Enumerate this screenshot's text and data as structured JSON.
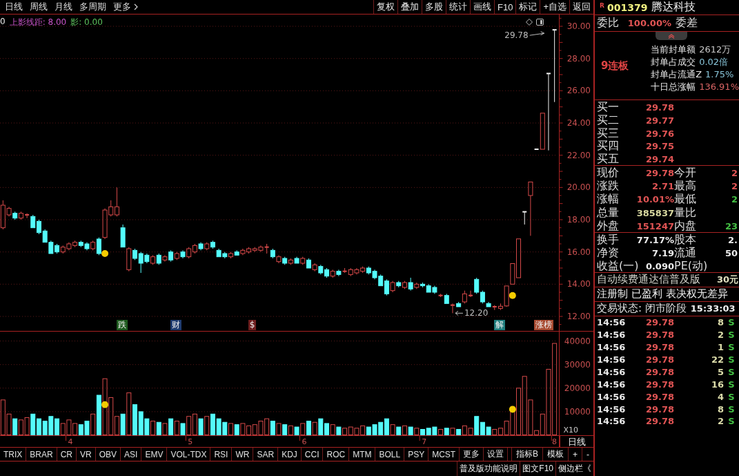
{
  "top_menu": {
    "items": [
      "日线",
      "周线",
      "月线",
      "多周期"
    ],
    "more": "更多"
  },
  "toolbar": [
    "复权",
    "叠加",
    "多股",
    "统计",
    "画线",
    "F10",
    "标记",
    "+自选",
    "返回"
  ],
  "chart_area": {
    "indicator_readout": {
      "prefix": "0",
      "items": [
        {
          "label": "上影线距:",
          "value": "8.00",
          "color": "#c854c8"
        },
        {
          "label": "影:",
          "value": "0.00",
          "color": "#5cc05c"
        }
      ]
    },
    "chart_data": [
      {
        "type": "candlestick",
        "ohlc": [
          [
            17.5,
            19.2,
            17.4,
            18.9
          ],
          [
            18.3,
            18.8,
            18.2,
            18.7
          ],
          [
            18.4,
            18.5,
            18.0,
            18.1
          ],
          [
            18.1,
            18.5,
            18.0,
            18.4
          ],
          [
            18.3,
            18.4,
            18.1,
            18.3
          ],
          [
            18.2,
            18.3,
            17.5,
            17.5
          ],
          [
            17.9,
            18.0,
            17.1,
            17.2
          ],
          [
            17.3,
            17.4,
            16.6,
            16.6
          ],
          [
            16.6,
            16.7,
            15.9,
            15.9
          ],
          [
            16.4,
            16.5,
            15.9,
            16.0
          ],
          [
            16.0,
            16.4,
            15.9,
            16.3
          ],
          [
            16.2,
            16.6,
            16.1,
            16.5
          ],
          [
            16.4,
            16.7,
            16.3,
            16.6
          ],
          [
            16.6,
            16.7,
            16.3,
            16.4
          ],
          [
            16.5,
            16.6,
            16.1,
            16.2
          ],
          [
            16.2,
            16.7,
            16.1,
            16.6
          ],
          [
            16.8,
            16.9,
            15.8,
            15.9
          ],
          [
            16.9,
            18.7,
            16.8,
            18.6
          ],
          [
            18.3,
            19.2,
            18.2,
            18.8
          ],
          [
            18.3,
            20.0,
            18.2,
            18.8
          ],
          [
            17.5,
            17.7,
            16.3,
            16.3
          ],
          [
            14.9,
            16.3,
            14.8,
            16.2
          ],
          [
            16.1,
            16.2,
            15.5,
            15.6
          ],
          [
            15.9,
            16.0,
            14.7,
            15.3
          ],
          [
            15.8,
            15.9,
            15.3,
            15.4
          ],
          [
            15.3,
            15.8,
            15.2,
            15.7
          ],
          [
            15.8,
            15.9,
            15.2,
            15.3
          ],
          [
            15.5,
            15.8,
            15.4,
            15.7
          ],
          [
            16.0,
            16.1,
            15.4,
            15.5
          ],
          [
            15.6,
            16.0,
            15.5,
            15.9
          ],
          [
            16.0,
            16.1,
            15.6,
            15.7
          ],
          [
            15.7,
            16.3,
            15.6,
            16.2
          ],
          [
            16.0,
            16.5,
            15.9,
            16.4
          ],
          [
            16.5,
            16.6,
            16.1,
            16.2
          ],
          [
            16.2,
            16.6,
            16.1,
            16.5
          ],
          [
            16.6,
            16.7,
            16.2,
            16.3
          ],
          [
            16.1,
            16.2,
            15.7,
            15.7
          ],
          [
            15.9,
            16.0,
            15.6,
            15.7
          ],
          [
            15.7,
            16.0,
            15.6,
            15.9
          ],
          [
            16.0,
            16.1,
            15.8,
            15.8
          ],
          [
            15.9,
            16.2,
            15.8,
            16.1
          ],
          [
            16.0,
            16.3,
            15.9,
            16.2
          ],
          [
            16.1,
            16.3,
            16.0,
            16.2
          ],
          [
            16.1,
            16.4,
            16.0,
            16.3
          ],
          [
            16.3,
            16.5,
            15.9,
            16.3
          ],
          [
            16.1,
            16.2,
            15.6,
            15.7
          ],
          [
            15.4,
            15.8,
            15.3,
            15.7
          ],
          [
            15.6,
            15.7,
            15.2,
            15.3
          ],
          [
            15.3,
            15.6,
            15.2,
            15.5
          ],
          [
            15.6,
            15.7,
            15.3,
            15.3
          ],
          [
            15.3,
            15.7,
            15.2,
            15.6
          ],
          [
            15.5,
            15.6,
            15.0,
            15.0
          ],
          [
            14.9,
            15.3,
            14.8,
            15.2
          ],
          [
            15.1,
            15.2,
            14.6,
            14.7
          ],
          [
            14.9,
            15.0,
            14.4,
            14.5
          ],
          [
            14.5,
            14.9,
            14.4,
            14.8
          ],
          [
            14.8,
            14.9,
            14.5,
            14.6
          ],
          [
            14.8,
            15.0,
            14.7,
            14.8
          ],
          [
            14.6,
            15.0,
            14.5,
            14.9
          ],
          [
            14.7,
            15.0,
            14.6,
            14.9
          ],
          [
            14.8,
            15.1,
            14.7,
            15.0
          ],
          [
            15.0,
            15.1,
            14.6,
            14.7
          ],
          [
            14.8,
            14.9,
            14.3,
            14.4
          ],
          [
            14.5,
            14.6,
            13.9,
            13.9
          ],
          [
            14.2,
            14.3,
            13.3,
            13.4
          ],
          [
            13.6,
            14.2,
            13.5,
            14.1
          ],
          [
            14.1,
            14.2,
            13.8,
            13.9
          ],
          [
            13.8,
            14.2,
            13.7,
            14.1
          ],
          [
            14.1,
            14.4,
            13.6,
            13.7
          ],
          [
            13.8,
            14.1,
            13.7,
            14.0
          ],
          [
            14.0,
            14.1,
            13.8,
            13.9
          ],
          [
            13.9,
            14.0,
            13.5,
            13.5
          ],
          [
            13.8,
            13.9,
            13.4,
            13.5
          ],
          [
            13.3,
            13.4,
            13.2,
            13.3
          ],
          [
            13.3,
            13.4,
            12.8,
            12.8
          ],
          [
            12.7,
            12.8,
            12.2,
            12.7
          ],
          [
            12.8,
            12.9,
            12.6,
            12.6
          ],
          [
            12.9,
            13.6,
            12.8,
            13.4
          ],
          [
            13.3,
            13.6,
            13.2,
            13.3
          ],
          [
            14.3,
            14.4,
            13.4,
            13.5
          ],
          [
            13.5,
            13.6,
            12.8,
            12.9
          ],
          [
            12.8,
            12.9,
            12.6,
            12.6
          ],
          [
            12.6,
            12.7,
            12.4,
            12.6
          ],
          [
            12.5,
            12.8,
            12.4,
            12.63
          ],
          [
            12.65,
            13.89,
            12.6,
            13.89
          ],
          [
            14.0,
            15.28,
            14.0,
            15.28
          ],
          [
            14.4,
            16.81,
            14.4,
            16.81
          ],
          [
            18.49,
            18.49,
            17.7,
            18.49
          ],
          [
            19.5,
            20.34,
            17.0,
            20.34
          ],
          [
            22.37,
            22.37,
            22.37,
            22.37
          ],
          [
            22.37,
            24.61,
            22.37,
            24.61
          ],
          [
            27.07,
            27.07,
            22.3,
            27.07
          ],
          [
            29.78,
            29.78,
            25.3,
            29.78
          ]
        ],
        "series": [
          {
            "type": "scatter",
            "color": "#f5cc00",
            "values": [
              null,
              null,
              null,
              null,
              null,
              null,
              null,
              null,
              null,
              null,
              null,
              null,
              null,
              null,
              null,
              null,
              null,
              15.9,
              null,
              null,
              null,
              null,
              null,
              null,
              null,
              null,
              null,
              null,
              null,
              null,
              null,
              null,
              null,
              null,
              null,
              null,
              null,
              null,
              null,
              null,
              null,
              null,
              null,
              null,
              null,
              null,
              null,
              null,
              null,
              null,
              null,
              null,
              null,
              null,
              null,
              null,
              null,
              null,
              null,
              null,
              null,
              null,
              null,
              null,
              null,
              null,
              null,
              null,
              null,
              null,
              null,
              null,
              null,
              null,
              null,
              null,
              null,
              null,
              null,
              null,
              null,
              null,
              null,
              null,
              null,
              13.3,
              null,
              null,
              null,
              null,
              null,
              null,
              null
            ]
          }
        ],
        "ylim": [
          11.1,
          30.73
        ],
        "yticks": [
          {
            "value": 30,
            "label": "30.00"
          },
          {
            "value": 28,
            "label": "28.00"
          },
          {
            "value": 26,
            "label": "26.00"
          },
          {
            "value": 24,
            "label": "24.00"
          },
          {
            "value": 22,
            "label": "22.00"
          },
          {
            "value": 20,
            "label": "20.00"
          },
          {
            "value": 18,
            "label": "18.00"
          },
          {
            "value": 16,
            "label": "16.00"
          },
          {
            "value": 14,
            "label": "14.00"
          },
          {
            "value": 12,
            "label": "12.00"
          }
        ],
        "tick_labels": "y",
        "grid": true,
        "annotations": [
          "29.78",
          "12.20"
        ]
      },
      {
        "type": "bar",
        "categories": [
          null,
          null,
          null,
          null,
          null,
          null,
          null,
          null,
          null,
          null,
          null,
          "4",
          null,
          null,
          null,
          null,
          null,
          null,
          null,
          null,
          null,
          null,
          null,
          null,
          null,
          null,
          null,
          null,
          null,
          null,
          null,
          "5",
          null,
          null,
          null,
          null,
          null,
          null,
          null,
          null,
          null,
          null,
          null,
          null,
          null,
          null,
          null,
          null,
          null,
          null,
          "6",
          null,
          null,
          null,
          null,
          null,
          null,
          null,
          null,
          null,
          null,
          null,
          null,
          null,
          null,
          null,
          null,
          null,
          null,
          null,
          "7",
          null,
          null,
          null,
          null,
          null,
          null,
          null,
          null,
          null,
          null,
          null,
          null,
          null,
          null,
          null,
          null,
          null,
          null,
          null,
          null,
          null,
          "8"
        ],
        "values": [
          15000,
          9000,
          7000,
          6500,
          7500,
          9000,
          7000,
          6000,
          8000,
          7000,
          5000,
          6500,
          5000,
          4500,
          6000,
          9000,
          17000,
          24000,
          16000,
          8000,
          9000,
          18000,
          13000,
          10000,
          7000,
          6000,
          5500,
          5000,
          7000,
          6000,
          5000,
          8000,
          9000,
          7000,
          8000,
          9000,
          7000,
          5500,
          5000,
          4500,
          5000,
          4000,
          4500,
          6000,
          7000,
          6000,
          5000,
          4500,
          4000,
          3500,
          5000,
          6000,
          5500,
          7000,
          5000,
          4500,
          3500,
          3000,
          3500,
          3000,
          4000,
          3500,
          4500,
          5500,
          7000,
          4500,
          3500,
          4000,
          3500,
          3000,
          2500,
          3000,
          3500,
          2500,
          3000,
          3000,
          2500,
          4000,
          3000,
          8000,
          5500,
          3500,
          2500,
          3000,
          6000,
          12000,
          20000,
          25000,
          15000,
          2000,
          9000,
          28000,
          39000
        ],
        "colors": [
          "#d84a4a",
          "#d84a4a",
          "#54fcfc",
          "#d84a4a",
          "#d84a4a",
          "#54fcfc",
          "#54fcfc",
          "#54fcfc",
          "#54fcfc",
          "#54fcfc",
          "#d84a4a",
          "#d84a4a",
          "#d84a4a",
          "#54fcfc",
          "#54fcfc",
          "#d84a4a",
          "#54fcfc",
          "#d84a4a",
          "#d84a4a",
          "#d84a4a",
          "#54fcfc",
          "#d84a4a",
          "#54fcfc",
          "#54fcfc",
          "#54fcfc",
          "#d84a4a",
          "#54fcfc",
          "#d84a4a",
          "#54fcfc",
          "#d84a4a",
          "#54fcfc",
          "#d84a4a",
          "#d84a4a",
          "#54fcfc",
          "#d84a4a",
          "#54fcfc",
          "#54fcfc",
          "#54fcfc",
          "#d84a4a",
          "#54fcfc",
          "#d84a4a",
          "#d84a4a",
          "#d84a4a",
          "#d84a4a",
          "#d84a4a",
          "#54fcfc",
          "#d84a4a",
          "#54fcfc",
          "#d84a4a",
          "#54fcfc",
          "#d84a4a",
          "#54fcfc",
          "#d84a4a",
          "#54fcfc",
          "#54fcfc",
          "#d84a4a",
          "#54fcfc",
          "#d84a4a",
          "#d84a4a",
          "#d84a4a",
          "#d84a4a",
          "#54fcfc",
          "#54fcfc",
          "#54fcfc",
          "#54fcfc",
          "#d84a4a",
          "#54fcfc",
          "#d84a4a",
          "#54fcfc",
          "#d84a4a",
          "#54fcfc",
          "#54fcfc",
          "#54fcfc",
          "#d84a4a",
          "#54fcfc",
          "#d84a4a",
          "#54fcfc",
          "#d84a4a",
          "#d84a4a",
          "#54fcfc",
          "#54fcfc",
          "#54fcfc",
          "#d84a4a",
          "#d84a4a",
          "#d84a4a",
          "#d84a4a",
          "#d84a4a",
          "#d84a4a",
          "#d84a4a",
          "#d84a4a",
          "#d84a4a",
          "#d84a4a",
          "#d84a4a"
        ],
        "series": [
          {
            "type": "scatter",
            "color": "#f5cc00",
            "values": [
              null,
              null,
              null,
              null,
              null,
              null,
              null,
              null,
              null,
              null,
              null,
              null,
              null,
              null,
              null,
              null,
              null,
              13000,
              null,
              null,
              null,
              null,
              null,
              null,
              null,
              null,
              null,
              null,
              null,
              null,
              null,
              null,
              null,
              null,
              null,
              null,
              null,
              null,
              null,
              null,
              null,
              null,
              null,
              null,
              null,
              null,
              null,
              null,
              null,
              null,
              null,
              null,
              null,
              null,
              null,
              null,
              null,
              null,
              null,
              null,
              null,
              null,
              null,
              null,
              null,
              null,
              null,
              null,
              null,
              null,
              null,
              null,
              null,
              null,
              null,
              null,
              null,
              null,
              null,
              null,
              null,
              null,
              null,
              null,
              null,
              11000,
              null,
              null,
              null,
              null,
              null,
              null,
              null
            ]
          }
        ],
        "ylim": [
          0,
          44000
        ],
        "yticks": [
          {
            "value": 40000,
            "label": "40000"
          },
          {
            "value": 30000,
            "label": "30000"
          },
          {
            "value": 20000,
            "label": "20000"
          },
          {
            "value": 10000,
            "label": "10000"
          }
        ],
        "ylabel": "X10",
        "grid": true
      }
    ],
    "event_tags": [
      {
        "label": "跌",
        "color": "#1e5a1e"
      },
      {
        "label": "财",
        "color": "#1e3a6e"
      },
      {
        "label": "$",
        "color": "#6e1e1e"
      },
      {
        "label": "解",
        "color": "#207e7e"
      },
      {
        "label": "涨榜",
        "color": "#a84a30"
      }
    ],
    "period_button": "日线"
  },
  "indicator_tabs": [
    "TRIX",
    "BRAR",
    "CR",
    "VR",
    "OBV",
    "ASI",
    "EMV",
    "VOL-TDX",
    "RSI",
    "WR",
    "SAR",
    "KDJ",
    "CCI",
    "ROC",
    "MTM",
    "BOLL",
    "PSY",
    "MCST",
    "更多",
    "设置"
  ],
  "template_buttons": [
    "指标B",
    "模板",
    "+",
    "-"
  ],
  "bottom_links": [
    "普及版功能说明",
    "图文F10",
    "侧边栏《"
  ],
  "quote_panel": {
    "stock": {
      "badge": "R",
      "code": "001379",
      "name": "腾达科技"
    },
    "order_ratio": {
      "label": "委比",
      "value": "100.00%",
      "diff_label": "委差"
    },
    "limit_streak": {
      "title": "9连板",
      "stats": [
        {
          "label": "当前封单额",
          "value": "2612万",
          "color": "#c8c8c8"
        },
        {
          "label": "封单占成交",
          "value": "0.02倍",
          "color": "#88c4d8"
        },
        {
          "label": "封单占流通Z",
          "value": "1.75%",
          "color": "#88c4d8"
        },
        {
          "label": "十日总涨幅",
          "value": "136.91%",
          "color": "#d86464"
        }
      ]
    },
    "bids": [
      {
        "label": "买一",
        "price": "29.78"
      },
      {
        "label": "买二",
        "price": "29.77"
      },
      {
        "label": "买三",
        "price": "29.76"
      },
      {
        "label": "买四",
        "price": "29.75"
      },
      {
        "label": "买五",
        "price": "29.74"
      }
    ],
    "quotes": [
      {
        "left": {
          "label": "现价",
          "value": "29.78",
          "color": "#e05454"
        },
        "right": {
          "label": "今开",
          "value": "2",
          "color": "#e05454"
        }
      },
      {
        "left": {
          "label": "涨跌",
          "value": "2.71",
          "color": "#e05454"
        },
        "right": {
          "label": "最高",
          "value": "2",
          "color": "#e05454"
        }
      },
      {
        "left": {
          "label": "涨幅",
          "value": "10.01%",
          "color": "#e05454"
        },
        "right": {
          "label": "最低",
          "value": "2",
          "color": "#44c044"
        }
      },
      {
        "left": {
          "label": "总量",
          "value": "385837",
          "color": "#d8d8a0"
        },
        "right": {
          "label": "量比"
        }
      },
      {
        "left": {
          "label": "外盘",
          "value": "151247",
          "color": "#e05454"
        },
        "right": {
          "label": "内盘",
          "value": "23",
          "color": "#44c044"
        }
      }
    ],
    "fundamentals": [
      {
        "left": {
          "label": "换手",
          "value": "77.17%"
        },
        "right": {
          "label": "股本",
          "value": "2."
        }
      },
      {
        "left": {
          "label": "净资",
          "value": "7.19"
        },
        "right": {
          "label": "流通",
          "value": "50"
        }
      },
      {
        "left": {
          "label": "收益(一)",
          "value": "0.090"
        },
        "right": {
          "label": "PE(动)"
        }
      }
    ],
    "promo": {
      "text": "自动续费通达信普及版",
      "price": "30元"
    },
    "tags_line": "注册制 已盈利 表决权无差异",
    "trade_status": {
      "label": "交易状态: 闭市阶段",
      "time": "15:33:03"
    },
    "ticks": [
      {
        "time": "14:56",
        "price": "29.78",
        "volume": "8",
        "side": "S"
      },
      {
        "time": "14:56",
        "price": "29.78",
        "volume": "2",
        "side": "S"
      },
      {
        "time": "14:56",
        "price": "29.78",
        "volume": "1",
        "side": "S"
      },
      {
        "time": "14:56",
        "price": "29.78",
        "volume": "22",
        "side": "S"
      },
      {
        "time": "14:56",
        "price": "29.78",
        "volume": "5",
        "side": "S"
      },
      {
        "time": "14:56",
        "price": "29.78",
        "volume": "16",
        "side": "S"
      },
      {
        "time": "14:56",
        "price": "29.78",
        "volume": "4",
        "side": "S"
      },
      {
        "time": "14:56",
        "price": "29.78",
        "volume": "8",
        "side": "S"
      },
      {
        "time": "14:56",
        "price": "29.78",
        "volume": "2",
        "side": "S"
      }
    ]
  }
}
